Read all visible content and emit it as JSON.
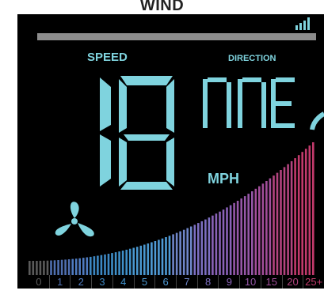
{
  "display": {
    "title": "WIND",
    "speed_label": "SPEED",
    "direction_label": "DIRECTION",
    "speed_value": "18",
    "direction_value": "NNE",
    "unit": "MPH"
  },
  "icons": {
    "signal": "signal-strength-icon",
    "fan": "fan-icon"
  },
  "scale_ticks": [
    "0",
    "1",
    "2",
    "3",
    "4",
    "5",
    "6",
    "7",
    "8",
    "9",
    "10",
    "15",
    "20",
    "25+"
  ],
  "colors": {
    "background": "#000000",
    "segment": "#7fd3de",
    "title_bar": "#8c8c8c",
    "tick_colors": [
      "#5a5a5a",
      "#4f6fb0",
      "#4f7bc0",
      "#3d87c2",
      "#3f8fc8",
      "#4a98d0",
      "#4f9ad5",
      "#6f86c9",
      "#7d6fc2",
      "#8a62b8",
      "#9657a8",
      "#a24e9a",
      "#b3447f",
      "#c23a6c"
    ]
  }
}
